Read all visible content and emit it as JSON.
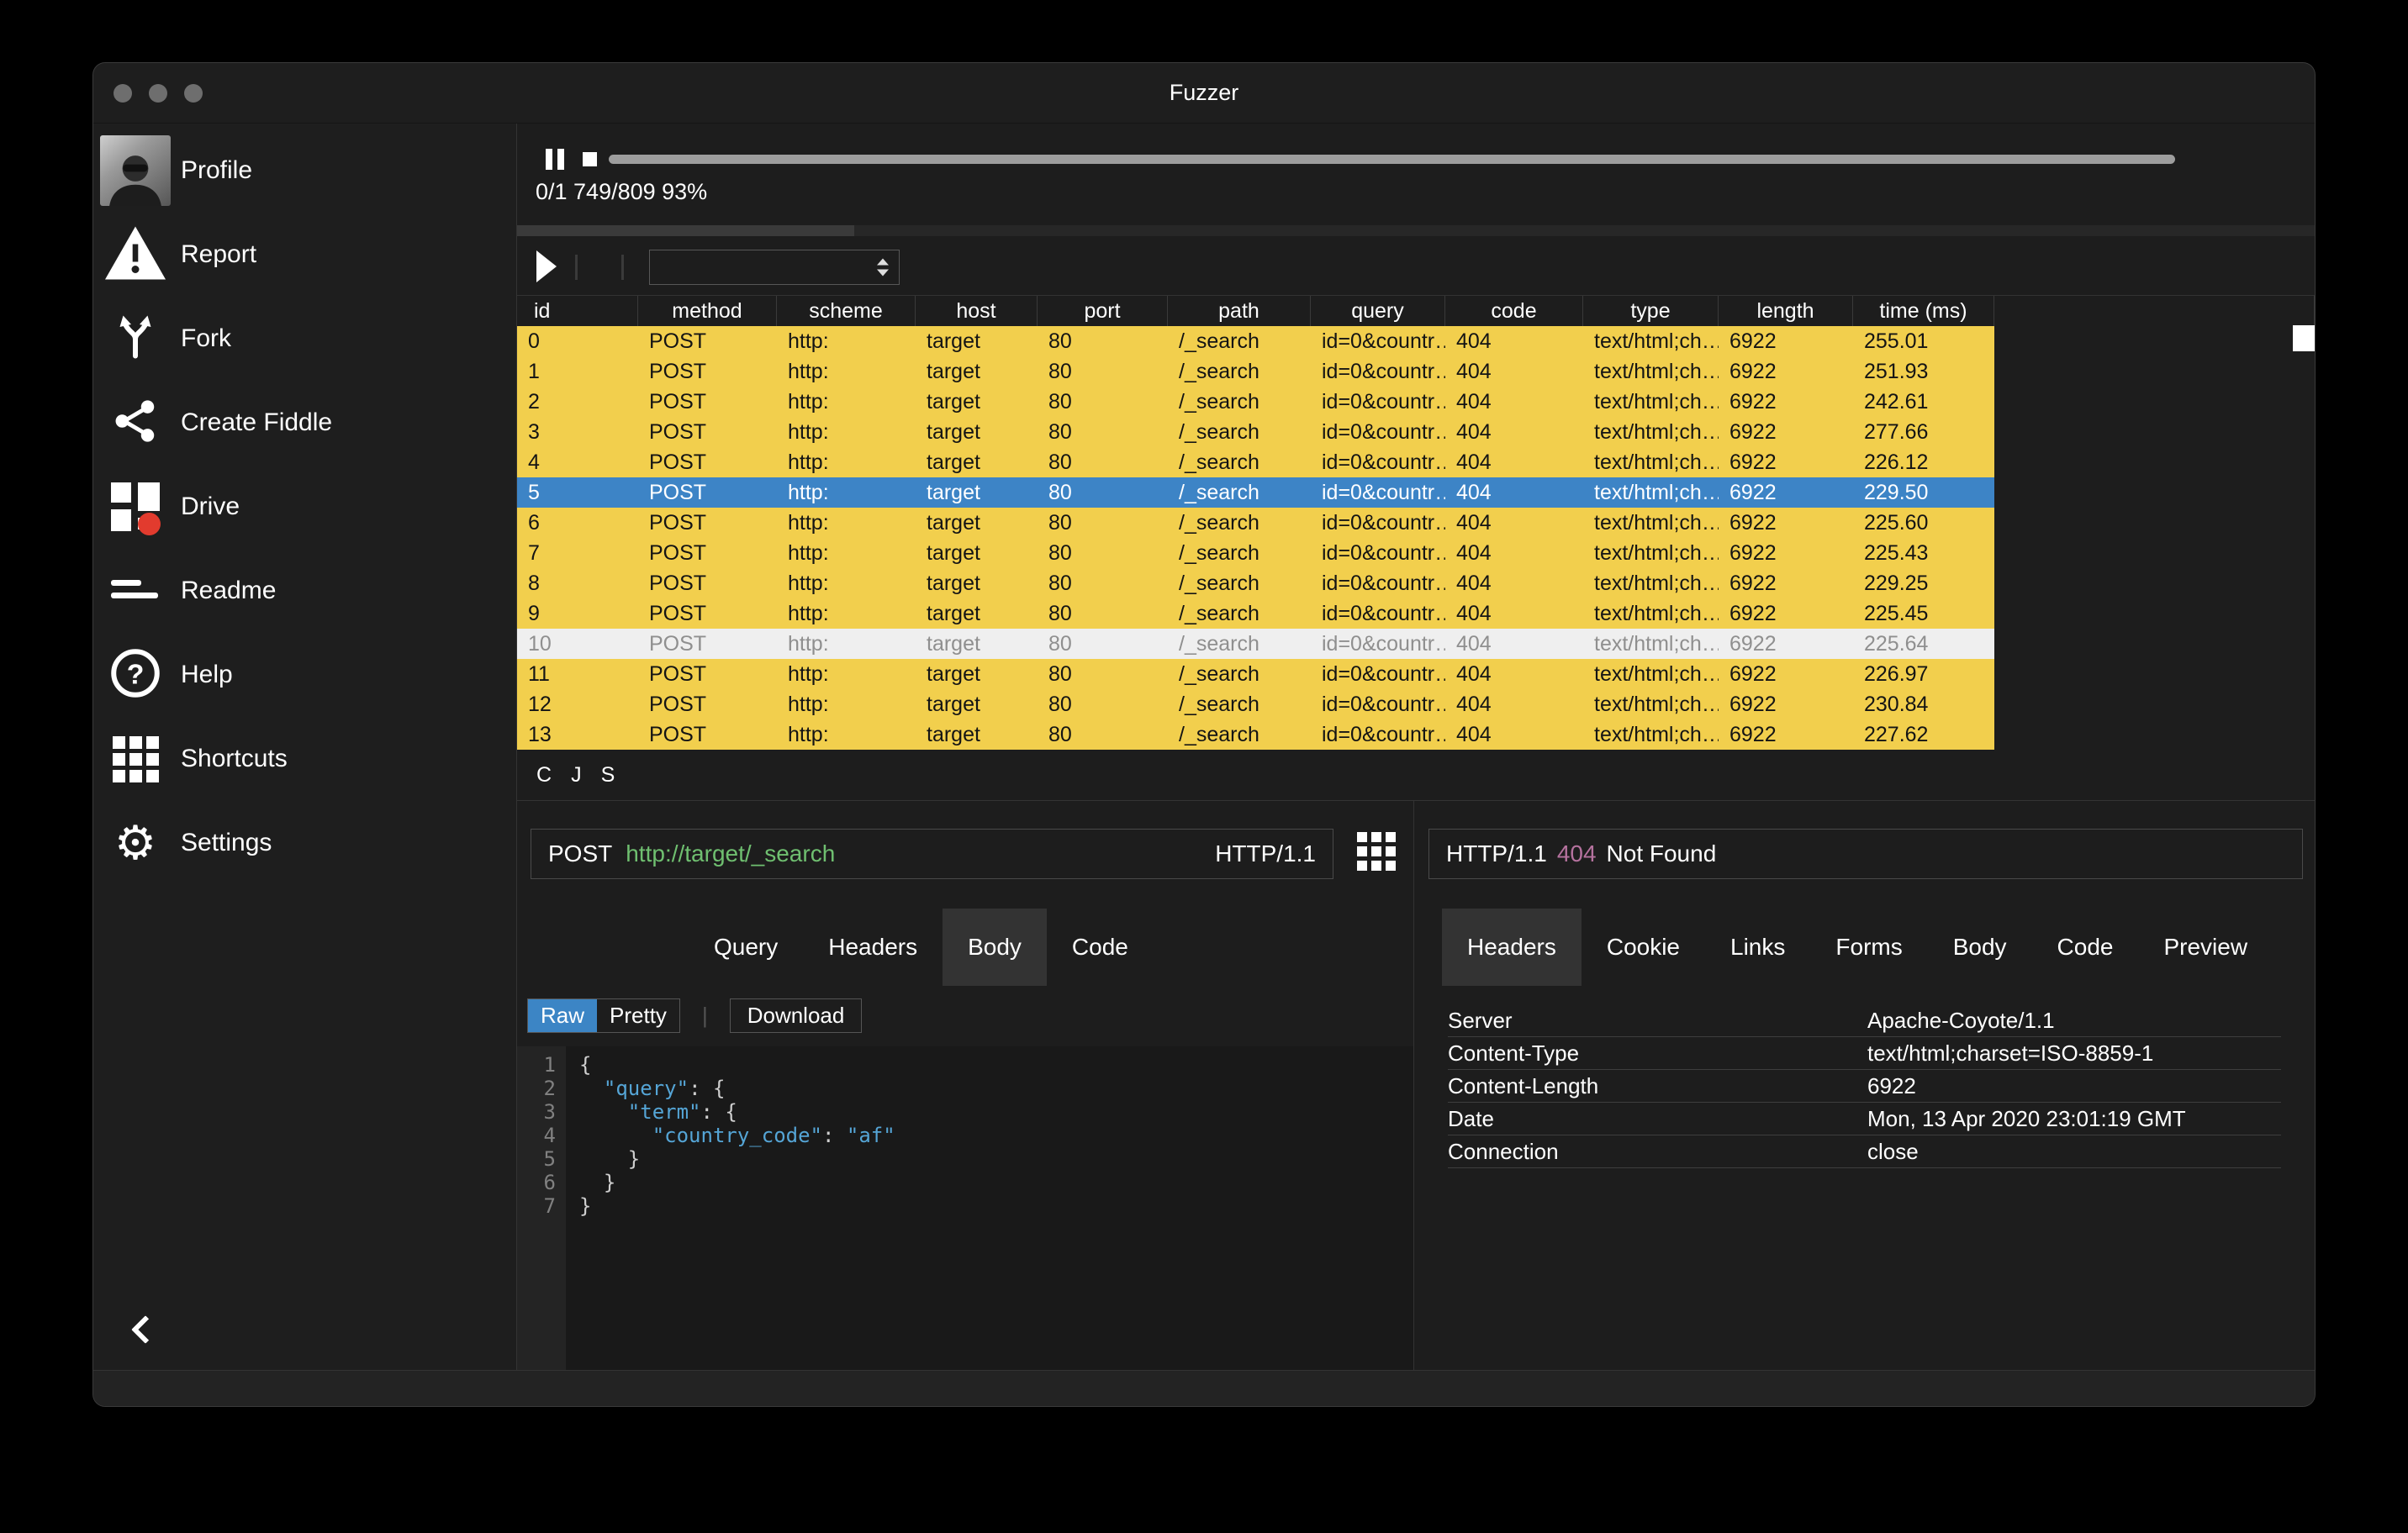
{
  "window": {
    "title": "Fuzzer"
  },
  "sidebar": {
    "items": [
      {
        "id": "profile",
        "label": "Profile"
      },
      {
        "id": "report",
        "label": "Report"
      },
      {
        "id": "fork",
        "label": "Fork"
      },
      {
        "id": "create-fiddle",
        "label": "Create Fiddle"
      },
      {
        "id": "drive",
        "label": "Drive"
      },
      {
        "id": "readme",
        "label": "Readme"
      },
      {
        "id": "help",
        "label": "Help"
      },
      {
        "id": "shortcuts",
        "label": "Shortcuts"
      },
      {
        "id": "settings",
        "label": "Settings"
      }
    ]
  },
  "controls": {
    "progress_text": "0/1 749/809 93%"
  },
  "table": {
    "columns": [
      "id",
      "method",
      "scheme",
      "host",
      "port",
      "path",
      "query",
      "code",
      "type",
      "length",
      "time (ms)"
    ],
    "rows": [
      [
        "0",
        "POST",
        "http:",
        "target",
        "80",
        "/_search",
        "id=0&countr…",
        "404",
        "text/html;ch…",
        "6922",
        "255.01"
      ],
      [
        "1",
        "POST",
        "http:",
        "target",
        "80",
        "/_search",
        "id=0&countr…",
        "404",
        "text/html;ch…",
        "6922",
        "251.93"
      ],
      [
        "2",
        "POST",
        "http:",
        "target",
        "80",
        "/_search",
        "id=0&countr…",
        "404",
        "text/html;ch…",
        "6922",
        "242.61"
      ],
      [
        "3",
        "POST",
        "http:",
        "target",
        "80",
        "/_search",
        "id=0&countr…",
        "404",
        "text/html;ch…",
        "6922",
        "277.66"
      ],
      [
        "4",
        "POST",
        "http:",
        "target",
        "80",
        "/_search",
        "id=0&countr…",
        "404",
        "text/html;ch…",
        "6922",
        "226.12"
      ],
      [
        "5",
        "POST",
        "http:",
        "target",
        "80",
        "/_search",
        "id=0&countr…",
        "404",
        "text/html;ch…",
        "6922",
        "229.50"
      ],
      [
        "6",
        "POST",
        "http:",
        "target",
        "80",
        "/_search",
        "id=0&countr…",
        "404",
        "text/html;ch…",
        "6922",
        "225.60"
      ],
      [
        "7",
        "POST",
        "http:",
        "target",
        "80",
        "/_search",
        "id=0&countr…",
        "404",
        "text/html;ch…",
        "6922",
        "225.43"
      ],
      [
        "8",
        "POST",
        "http:",
        "target",
        "80",
        "/_search",
        "id=0&countr…",
        "404",
        "text/html;ch…",
        "6922",
        "229.25"
      ],
      [
        "9",
        "POST",
        "http:",
        "target",
        "80",
        "/_search",
        "id=0&countr…",
        "404",
        "text/html;ch…",
        "6922",
        "225.45"
      ],
      [
        "10",
        "POST",
        "http:",
        "target",
        "80",
        "/_search",
        "id=0&countr…",
        "404",
        "text/html;ch…",
        "6922",
        "225.64"
      ],
      [
        "11",
        "POST",
        "http:",
        "target",
        "80",
        "/_search",
        "id=0&countr…",
        "404",
        "text/html;ch…",
        "6922",
        "226.97"
      ],
      [
        "12",
        "POST",
        "http:",
        "target",
        "80",
        "/_search",
        "id=0&countr…",
        "404",
        "text/html;ch…",
        "6922",
        "230.84"
      ],
      [
        "13",
        "POST",
        "http:",
        "target",
        "80",
        "/_search",
        "id=0&countr…",
        "404",
        "text/html;ch…",
        "6922",
        "227.62"
      ]
    ],
    "selected_row": 5,
    "highlight_row": 10
  },
  "row_actions": [
    "C",
    "J",
    "S"
  ],
  "request": {
    "method": "POST",
    "url": "http://target/_search",
    "version": "HTTP/1.1",
    "tabs": [
      "Query",
      "Headers",
      "Body",
      "Code"
    ],
    "active_tab": "Body",
    "toolbar": {
      "raw": "Raw",
      "pretty": "Pretty",
      "download": "Download"
    },
    "code_lines": [
      {
        "num": "1",
        "parts": [
          {
            "t": "{",
            "k": "p"
          }
        ]
      },
      {
        "num": "2",
        "parts": [
          {
            "t": "  ",
            "k": "p"
          },
          {
            "t": "\"query\"",
            "k": "b"
          },
          {
            "t": ": {",
            "k": "p"
          }
        ]
      },
      {
        "num": "3",
        "parts": [
          {
            "t": "    ",
            "k": "p"
          },
          {
            "t": "\"term\"",
            "k": "b"
          },
          {
            "t": ": {",
            "k": "p"
          }
        ]
      },
      {
        "num": "4",
        "parts": [
          {
            "t": "      ",
            "k": "p"
          },
          {
            "t": "\"country_code\"",
            "k": "b"
          },
          {
            "t": ": ",
            "k": "p"
          },
          {
            "t": "\"af\"",
            "k": "b"
          }
        ]
      },
      {
        "num": "5",
        "parts": [
          {
            "t": "    }",
            "k": "p"
          }
        ]
      },
      {
        "num": "6",
        "parts": [
          {
            "t": "  }",
            "k": "p"
          }
        ]
      },
      {
        "num": "7",
        "parts": [
          {
            "t": "}",
            "k": "p"
          }
        ]
      }
    ]
  },
  "response": {
    "version": "HTTP/1.1",
    "status_code": "404",
    "status_text": "Not Found",
    "tabs": [
      "Headers",
      "Cookie",
      "Links",
      "Forms",
      "Body",
      "Code",
      "Preview"
    ],
    "active_tab": "Headers",
    "headers": [
      {
        "name": "Server",
        "value": "Apache-Coyote/1.1"
      },
      {
        "name": "Content-Type",
        "value": "text/html;charset=ISO-8859-1"
      },
      {
        "name": "Content-Length",
        "value": "6922"
      },
      {
        "name": "Date",
        "value": "Mon, 13 Apr 2020 23:01:19 GMT"
      },
      {
        "name": "Connection",
        "value": "close"
      }
    ]
  },
  "colors": {
    "row_yellow": "#f2cf4d",
    "row_selected_blue": "#3d84c6",
    "row_highlight": "#efefef",
    "url_green": "#6fbf70",
    "status_pink": "#b5729e",
    "raw_button_blue": "#3c85c5",
    "json_key_blue": "#55a5d6",
    "drive_dot_red": "#e23b2e"
  }
}
